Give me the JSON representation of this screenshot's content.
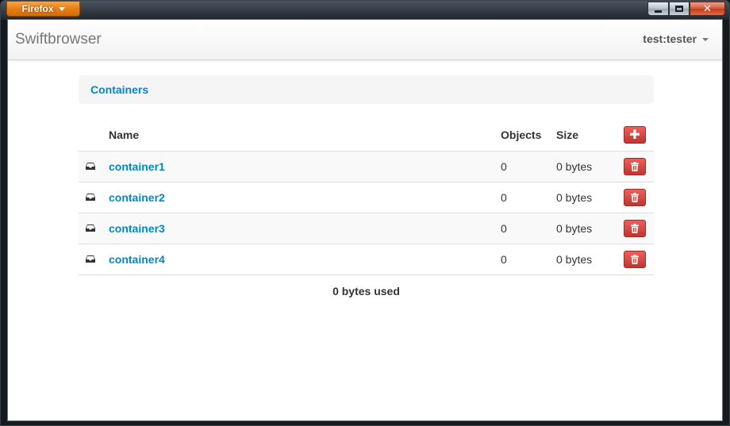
{
  "window": {
    "menu_button": "Firefox",
    "controls": {
      "minimize": "minimize",
      "maximize": "maximize",
      "close": "close"
    }
  },
  "navbar": {
    "brand": "Swiftbrowser",
    "user": "test:tester"
  },
  "breadcrumb": {
    "current": "Containers"
  },
  "table": {
    "headers": {
      "name": "Name",
      "objects": "Objects",
      "size": "Size"
    },
    "rows": [
      {
        "name": "container1",
        "objects": "0",
        "size": "0 bytes"
      },
      {
        "name": "container2",
        "objects": "0",
        "size": "0 bytes"
      },
      {
        "name": "container3",
        "objects": "0",
        "size": "0 bytes"
      },
      {
        "name": "container4",
        "objects": "0",
        "size": "0 bytes"
      }
    ]
  },
  "summary": "0 bytes used",
  "icons": {
    "row_icon": "inbox-icon",
    "delete": "trash-icon",
    "add": "plus-icon"
  },
  "colors": {
    "link": "#0088cc",
    "danger": "#da4f49",
    "firefox_orange": "#e57b12"
  }
}
